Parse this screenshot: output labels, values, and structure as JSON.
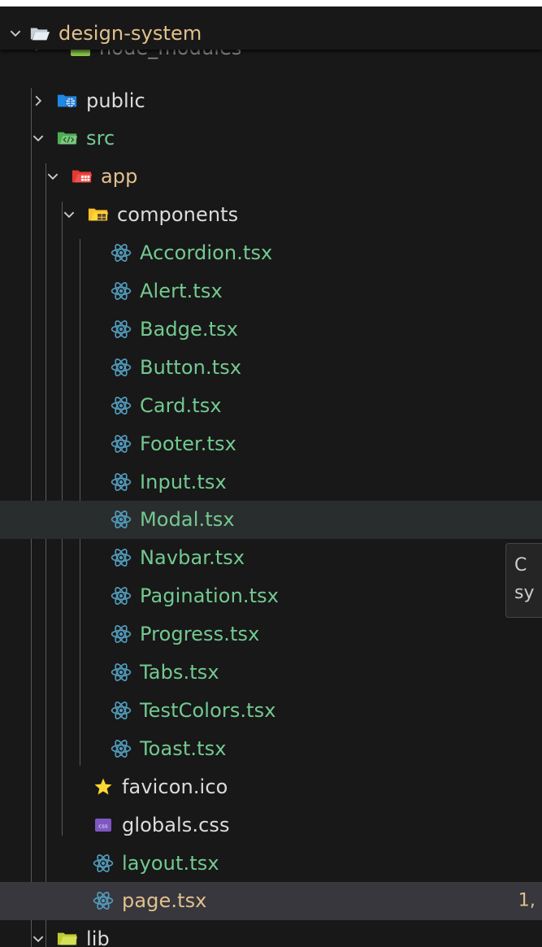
{
  "explorer": {
    "root": {
      "label": "design-system",
      "expanded": true
    },
    "partial_row": {
      "label": "node_modules"
    },
    "rows": [
      {
        "label": "public",
        "kind": "folder-public",
        "expanded": false,
        "depth": 1
      },
      {
        "label": "src",
        "kind": "folder-src",
        "expanded": true,
        "depth": 1
      },
      {
        "label": "app",
        "kind": "folder-app",
        "expanded": true,
        "depth": 2
      },
      {
        "label": "components",
        "kind": "folder-components",
        "expanded": true,
        "depth": 3
      },
      {
        "label": "Accordion.tsx",
        "kind": "react",
        "depth": 4
      },
      {
        "label": "Alert.tsx",
        "kind": "react",
        "depth": 4
      },
      {
        "label": "Badge.tsx",
        "kind": "react",
        "depth": 4
      },
      {
        "label": "Button.tsx",
        "kind": "react",
        "depth": 4
      },
      {
        "label": "Card.tsx",
        "kind": "react",
        "depth": 4
      },
      {
        "label": "Footer.tsx",
        "kind": "react",
        "depth": 4
      },
      {
        "label": "Input.tsx",
        "kind": "react",
        "depth": 4
      },
      {
        "label": "Modal.tsx",
        "kind": "react",
        "depth": 4,
        "state": "hover"
      },
      {
        "label": "Navbar.tsx",
        "kind": "react",
        "depth": 4
      },
      {
        "label": "Pagination.tsx",
        "kind": "react",
        "depth": 4
      },
      {
        "label": "Progress.tsx",
        "kind": "react",
        "depth": 4
      },
      {
        "label": "Tabs.tsx",
        "kind": "react",
        "depth": 4
      },
      {
        "label": "TestColors.tsx",
        "kind": "react",
        "depth": 4
      },
      {
        "label": "Toast.tsx",
        "kind": "react",
        "depth": 4
      },
      {
        "label": "favicon.ico",
        "kind": "star",
        "depth": 3
      },
      {
        "label": "globals.css",
        "kind": "css",
        "depth": 3
      },
      {
        "label": "layout.tsx",
        "kind": "react",
        "depth": 3
      },
      {
        "label": "page.tsx",
        "kind": "react",
        "depth": 3,
        "state": "selected",
        "badge": "1,"
      },
      {
        "label": "lib",
        "kind": "folder-lib",
        "expanded": true,
        "depth": 1
      }
    ],
    "tooltip": {
      "line1": "C",
      "line2": "sy"
    }
  },
  "colors": {
    "folder_text": "#e2c08d",
    "git_added_text": "#73c991",
    "react_icon": "#519aba",
    "background": "#181818"
  },
  "icons": {
    "chevron_expanded": "chevron-down-icon",
    "chevron_collapsed": "chevron-right-icon",
    "react": "react-icon",
    "star": "star-icon",
    "css": "css-icon"
  }
}
